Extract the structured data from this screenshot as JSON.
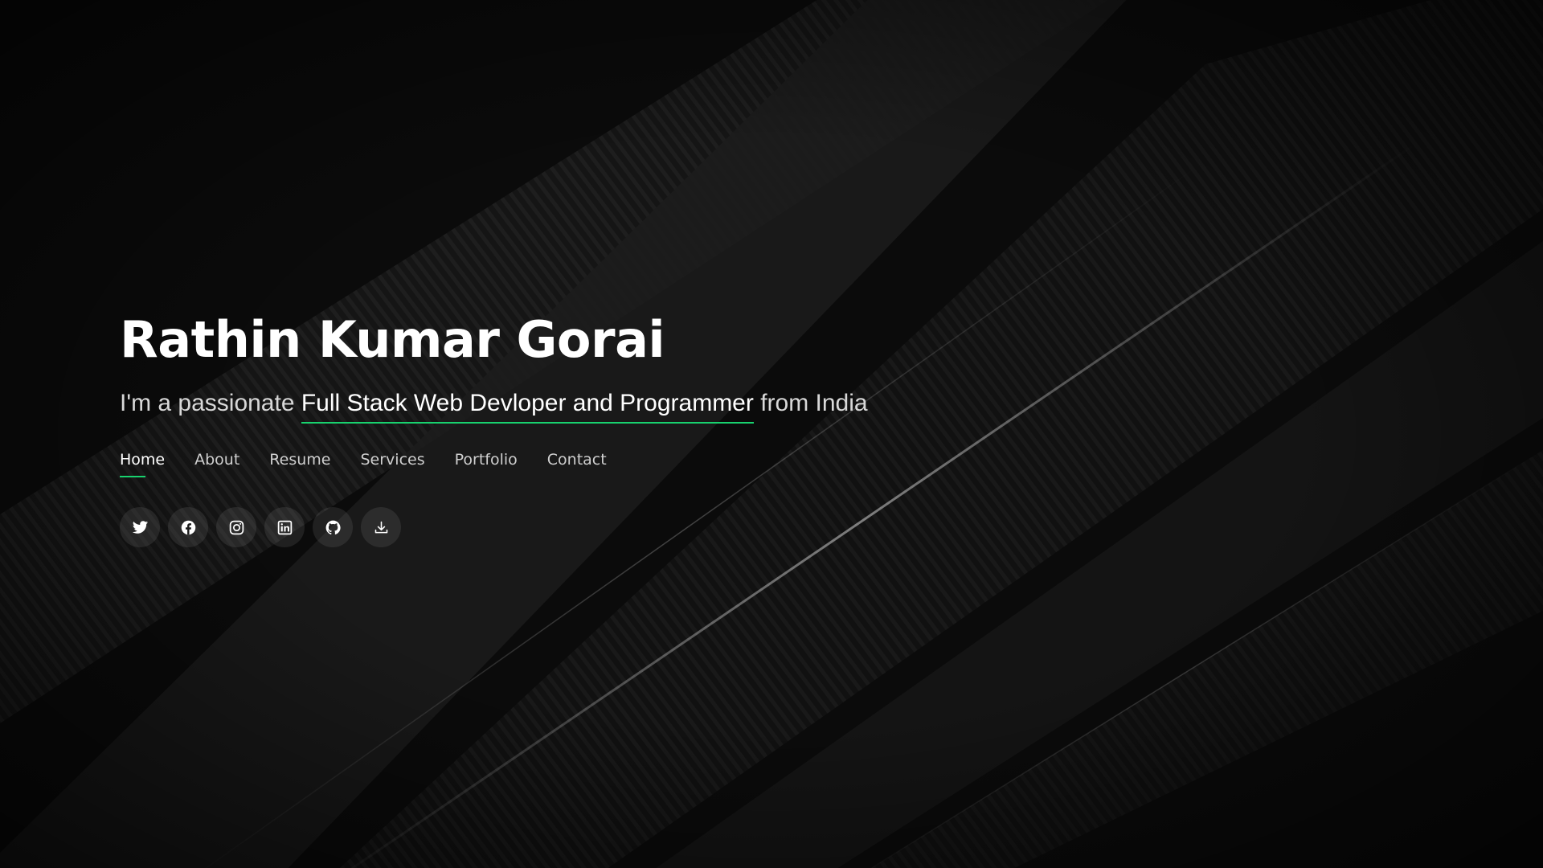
{
  "hero": {
    "name": "Rathin Kumar Gorai",
    "tagline_prefix": "I'm a passionate ",
    "tagline_highlight": "Full Stack Web Devloper and Programmer",
    "tagline_suffix": " from India"
  },
  "nav": {
    "items": [
      {
        "label": "Home",
        "active": true
      },
      {
        "label": "About",
        "active": false
      },
      {
        "label": "Resume",
        "active": false
      },
      {
        "label": "Services",
        "active": false
      },
      {
        "label": "Portfolio",
        "active": false
      },
      {
        "label": "Contact",
        "active": false
      }
    ]
  },
  "social": {
    "icons": [
      "twitter-icon",
      "facebook-icon",
      "instagram-icon",
      "linkedin-icon",
      "github-icon",
      "download-icon"
    ]
  },
  "colors": {
    "accent": "#18d26e",
    "background": "#0b0b0b",
    "text": "#ffffff"
  }
}
